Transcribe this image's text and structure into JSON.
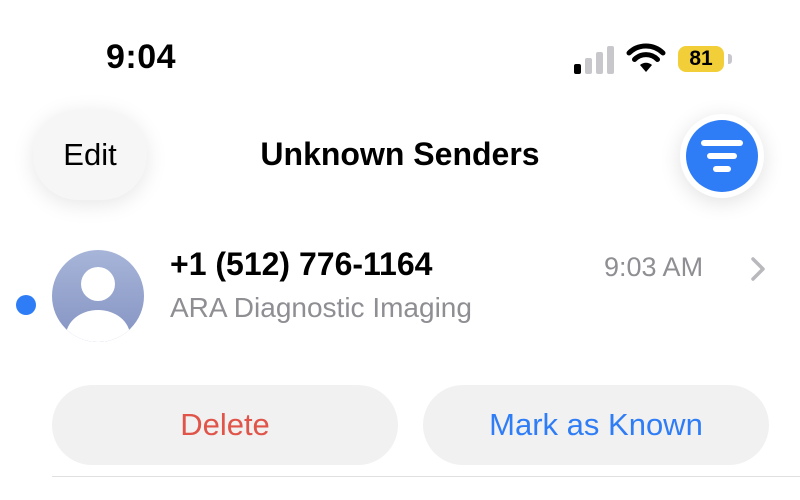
{
  "status_bar": {
    "time": "9:04",
    "battery_level": "81",
    "battery_color": "#f2cf38",
    "signal_icon": "cellular-signal-icon",
    "wifi_icon": "wifi-icon"
  },
  "header": {
    "edit_label": "Edit",
    "title": "Unknown Senders",
    "filter_icon": "filter-icon",
    "accent_color": "#2f7df6"
  },
  "conversation": {
    "sender": "+1 (512) 776-1164",
    "preview": "ARA Diagnostic Imaging",
    "time": "9:03 AM",
    "unread": true
  },
  "actions": {
    "delete_label": "Delete",
    "delete_color": "#e0544a",
    "mark_known_label": "Mark as Known",
    "mark_known_color": "#2f7df6"
  }
}
